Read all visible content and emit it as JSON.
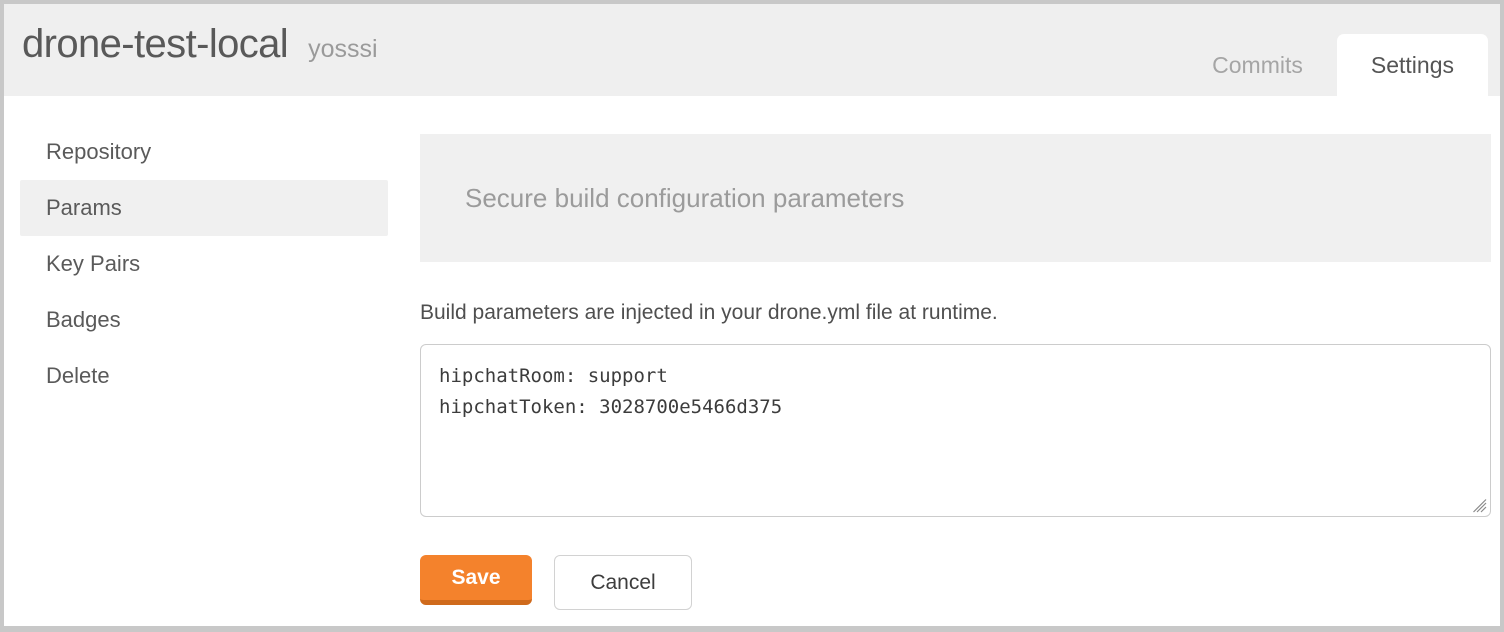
{
  "header": {
    "repo_name": "drone-test-local",
    "repo_owner": "yosssi",
    "tabs": [
      {
        "label": "Commits",
        "active": false
      },
      {
        "label": "Settings",
        "active": true
      }
    ]
  },
  "sidebar": {
    "items": [
      {
        "label": "Repository",
        "active": false
      },
      {
        "label": "Params",
        "active": true
      },
      {
        "label": "Key Pairs",
        "active": false
      },
      {
        "label": "Badges",
        "active": false
      },
      {
        "label": "Delete",
        "active": false
      }
    ]
  },
  "main": {
    "panel_title": "Secure build configuration parameters",
    "description": "Build parameters are injected in your drone.yml file at runtime.",
    "textarea": {
      "value": "hipchatRoom: support\nhipchatToken: 3028700e5466d375",
      "placeholder": ""
    },
    "buttons": {
      "save_label": "Save",
      "cancel_label": "Cancel"
    }
  },
  "colors": {
    "accent_orange": "#f4822c",
    "accent_orange_dark": "#cf6a1c",
    "panel_gray": "#f0f0f0",
    "header_gray": "#efefef",
    "frame_gray": "#c8c8c8",
    "text_dark": "#4f4f4f",
    "text_muted": "#9b9b9b"
  }
}
